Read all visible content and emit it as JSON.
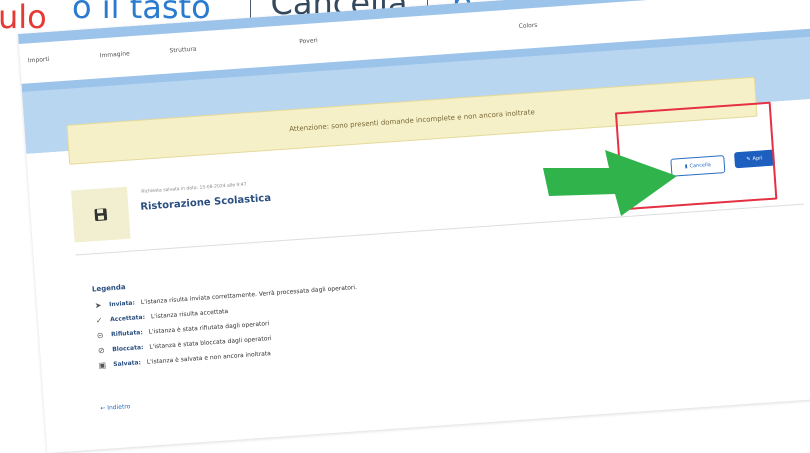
{
  "caption": {
    "part1": "ulo",
    "part2": "o il tasto",
    "button": "Cancella",
    "tail": "p"
  },
  "columns": [
    "Importi",
    "Immagine",
    "Struttura",
    "Poveri",
    "Colors"
  ],
  "warning": "Attenzione: sono presenti domande incomplete e non ancora inoltrate",
  "card": {
    "meta": "Richiesta salvata in data: 15-08-2024 alle 9:47",
    "title": "Ristorazione Scolastica",
    "cancel_label": "Cancella",
    "open_label": "Apri"
  },
  "legend": {
    "title": "Legenda",
    "items": [
      {
        "icon": "send-icon",
        "key": "Inviata:",
        "text": "L'istanza risulta inviata correttamente. Verrà processata dagli operatori."
      },
      {
        "icon": "check-icon",
        "key": "Accettata:",
        "text": "L'istanza risulta accettata"
      },
      {
        "icon": "refused-icon",
        "key": "Rifiutata:",
        "text": "L'istanza è stata rifiutata dagli operatori"
      },
      {
        "icon": "blocked-icon",
        "key": "Bloccata:",
        "text": "L'istanza è stata bloccata dagli operatori"
      },
      {
        "icon": "save-icon",
        "key": "Salvata:",
        "text": "L'istanza è salvata e non ancora inoltrata"
      }
    ]
  },
  "back_label": "Indietro",
  "colors": {
    "accent_blue": "#1d5fbf",
    "warning_bg": "#f6f0c8",
    "highlight_red": "#e53044",
    "arrow_green": "#2fb34a"
  }
}
